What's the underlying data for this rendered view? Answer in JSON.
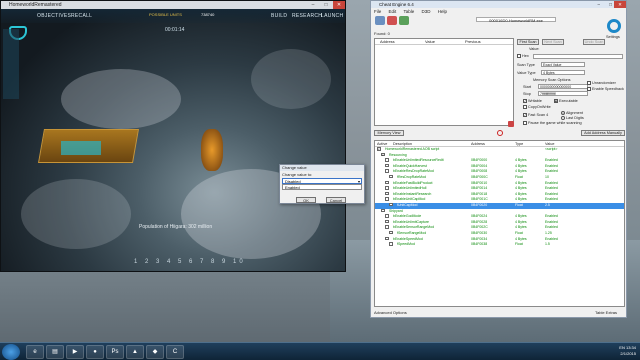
{
  "game": {
    "window_title": "HomeworldRemastered",
    "hud": {
      "objectives": "OBJECTIVES",
      "recall": "RECALL",
      "possible_units_label": "POSSIBLE UNITS",
      "possible_units_value": "738740",
      "build": "BUILD",
      "research": "RESEARCH",
      "launch": "LAUNCH",
      "timer": "00:01:14"
    },
    "population": "Population of Hiigara: 302 million",
    "numbers": "1 2 3 4 5 6 7 8 9 10"
  },
  "dialog": {
    "title": "Change value",
    "label": "Change value to:",
    "selected": "Disabled",
    "option": "Enabled",
    "ok": "OK",
    "cancel": "Cancel"
  },
  "ce": {
    "title": "Cheat Engine 6.4",
    "menu": [
      "File",
      "Edit",
      "Table",
      "D3D",
      "Help"
    ],
    "process": "000016D0-HomeworldRM.exe",
    "found": "Found: 0",
    "list_headers": [
      "Address",
      "Value",
      "Previous"
    ],
    "first_scan": "First Scan",
    "next_scan": "Next Scan",
    "undo_scan": "Undo Scan",
    "settings": "Settings",
    "value_label": "Value:",
    "hex": "Hex",
    "scan_type_label": "Scan Type",
    "scan_type": "Exact Value",
    "value_type_label": "Value Type",
    "value_type": "4 Bytes",
    "memory_scan_options": "Memory Scan Options",
    "start_label": "Start",
    "start_value": "0000000000000000",
    "stop_label": "Stop",
    "stop_value": "7fffffffffffffff",
    "writable": "Writable",
    "executable": "Executable",
    "copy_on_write": "CopyOnWrite",
    "fast_scan": "Fast Scan",
    "fast_scan_value": "4",
    "alignment": "Alignment",
    "last_digits": "Last Digits",
    "pause": "Pause the game while scanning",
    "unrandomizer": "Unrandomizer",
    "speedhack": "Enable Speedhack",
    "memory_view": "Memory View",
    "add_manually": "Add Address Manually",
    "table_headers": [
      "Active",
      "Description",
      "Address",
      "Type",
      "Value"
    ],
    "rows": [
      {
        "indent": 0,
        "check": "x",
        "desc": "HomeworldRemastered AOB script",
        "addr": "",
        "type": "",
        "val": "<script>"
      },
      {
        "indent": 1,
        "check": "x",
        "desc": "Resourcing",
        "addr": "",
        "type": "",
        "val": ""
      },
      {
        "indent": 2,
        "check": "",
        "desc": "bEnableUnlimitedResourceRedit",
        "addr": "0B4F0000",
        "type": "4 Bytes",
        "val": "Enabled"
      },
      {
        "indent": 2,
        "check": "",
        "desc": "bEnableQuickHarvest",
        "addr": "0B4F0004",
        "type": "4 Bytes",
        "val": "Enabled"
      },
      {
        "indent": 2,
        "check": "",
        "desc": "bEnableResDropRateMod",
        "addr": "0B4F0008",
        "type": "4 Bytes",
        "val": "Enabled"
      },
      {
        "indent": 3,
        "check": "",
        "desc": "fResDropRateMod",
        "addr": "0B4F000C",
        "type": "Float",
        "val": "10"
      },
      {
        "indent": 2,
        "check": "",
        "desc": "bEnableFastBuildProduct",
        "addr": "0B4F0010",
        "type": "4 Bytes",
        "val": "Enabled"
      },
      {
        "indent": 2,
        "check": "",
        "desc": "bEnableUnlimitedHull",
        "addr": "0B4F0014",
        "type": "4 Bytes",
        "val": "Enabled"
      },
      {
        "indent": 2,
        "check": "",
        "desc": "bEnableInstantResearch",
        "addr": "0B4F0018",
        "type": "4 Bytes",
        "val": "Enabled"
      },
      {
        "indent": 2,
        "check": "",
        "desc": "bEnableUnitCapMod",
        "addr": "0B4F001C",
        "type": "4 Bytes",
        "val": "Enabled"
      },
      {
        "indent": 3,
        "check": "",
        "desc": "fUnitCapMod",
        "addr": "0B4F0020",
        "type": "Float",
        "val": "2.5"
      },
      {
        "indent": 1,
        "check": "",
        "desc": "Shipyard",
        "addr": "",
        "type": "",
        "val": ""
      },
      {
        "indent": 2,
        "check": "",
        "desc": "bEnableGodMode",
        "addr": "0B4F0024",
        "type": "4 Bytes",
        "val": "Enabled"
      },
      {
        "indent": 2,
        "check": "",
        "desc": "bEnableUnlimitCapture",
        "addr": "0B4F0028",
        "type": "4 Bytes",
        "val": "Enabled"
      },
      {
        "indent": 2,
        "check": "",
        "desc": "bEnableSensorRangeMod",
        "addr": "0B4F002C",
        "type": "4 Bytes",
        "val": "Enabled"
      },
      {
        "indent": 3,
        "check": "",
        "desc": "fSensorRangeMod",
        "addr": "0B4F0030",
        "type": "Float",
        "val": "1.25"
      },
      {
        "indent": 2,
        "check": "",
        "desc": "bEnableSpeedMod",
        "addr": "0B4F0034",
        "type": "4 Bytes",
        "val": "Enabled"
      },
      {
        "indent": 3,
        "check": "",
        "desc": "fSpeedMod",
        "addr": "0B4F0038",
        "type": "Float",
        "val": "1.5"
      }
    ],
    "selected_row": 10,
    "advanced_options": "Advanced Options",
    "table_extras": "Table Extras"
  },
  "taskbar": {
    "lang": "EN",
    "time": "13:34",
    "date": "2/1/2015"
  }
}
